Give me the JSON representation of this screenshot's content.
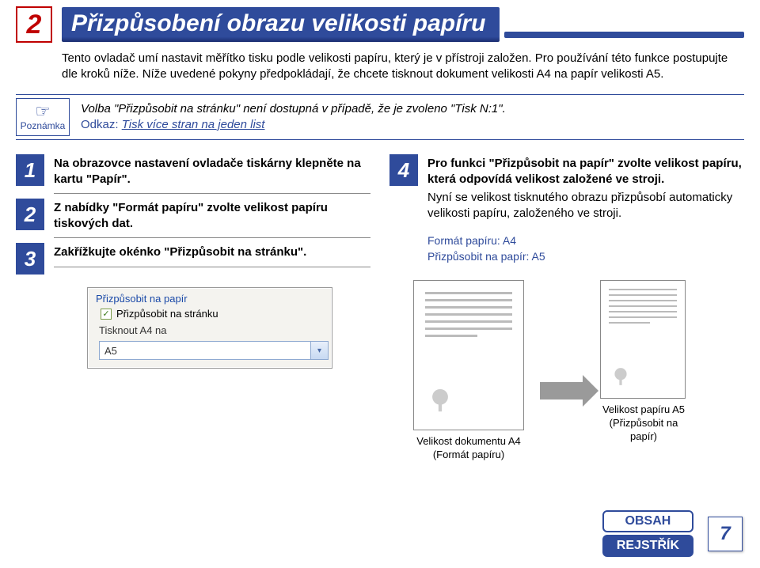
{
  "header": {
    "section_number": "2",
    "title": "Přizpůsobení obrazu velikosti papíru"
  },
  "intro": "Tento ovladač umí nastavit měřítko tisku podle velikosti papíru, který je v přístroji založen. Pro používání této funkce postupujte dle kroků níže. Níže uvedené pokyny předpokládají, že chcete tisknout dokument velikosti A4 na papír velikosti A5.",
  "note": {
    "label": "Poznámka",
    "text": "Volba \"Přizpůsobit na stránku\" není dostupná v případě, že je zvoleno \"Tisk N:1\".",
    "odkaz_label": "Odkaz:",
    "link_text": "Tisk více stran na jeden list"
  },
  "steps_left": [
    {
      "n": "1",
      "text": "Na obrazovce nastavení ovladače tiskárny klepněte na kartu \"Papír\"."
    },
    {
      "n": "2",
      "text": "Z nabídky \"Formát papíru\" zvolte velikost papíru tiskových dat."
    },
    {
      "n": "3",
      "text": "Zakřížkujte okénko \"Přizpůsobit na stránku\"."
    }
  ],
  "step4": {
    "n": "4",
    "text": "Pro funkci \"Přizpůsobit na papír\" zvolte velikost papíru, která odpovídá velikost založené ve stroji.",
    "extra": "Nyní se velikost tisknutého obrazu přizpůsobí automaticky velikosti papíru, založeného ve stroji.",
    "blue1": "Formát papíru: A4",
    "blue2": "Přizpůsobit na papír: A5"
  },
  "dialog": {
    "group_label": "Přizpůsobit na papír",
    "checkbox_label": "Přizpůsobit na stránku",
    "plain_label": "Tisknout A4 na",
    "select_value": "A5"
  },
  "diagram": {
    "left_caption_l1": "Velikost dokumentu A4",
    "left_caption_l2": "(Formát papíru)",
    "right_caption_l1": "Velikost papíru A5",
    "right_caption_l2": "(Přizpůsobit na papír)"
  },
  "footer": {
    "btn_obsah": "OBSAH",
    "btn_rejstrik": "REJSTŘÍK",
    "page": "7"
  }
}
